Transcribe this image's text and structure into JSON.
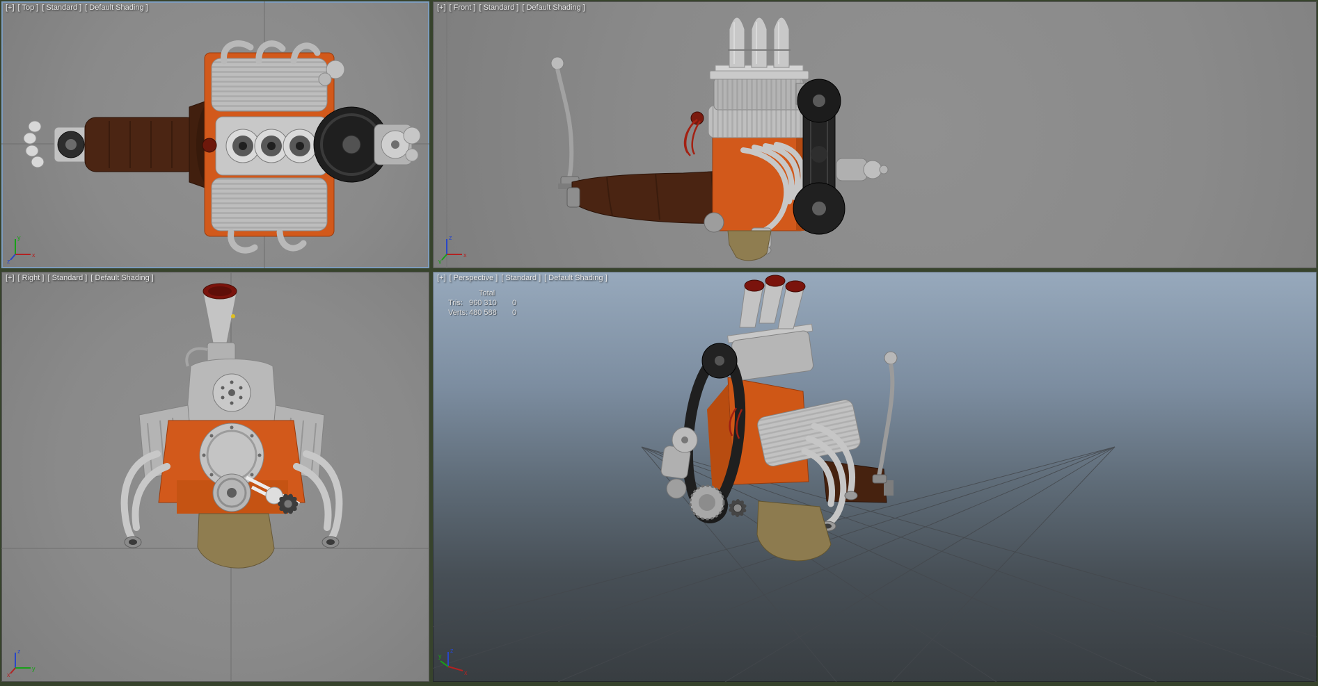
{
  "app": {
    "title": "3ds Max quad viewport - engine model"
  },
  "viewports": [
    {
      "id": "top",
      "menu_general": "[+]",
      "menu_pov": "[ Top ]",
      "menu_preset": "[ Standard ]",
      "menu_shading": "[ Default Shading ]",
      "active": true
    },
    {
      "id": "front",
      "menu_general": "[+]",
      "menu_pov": "[ Front ]",
      "menu_preset": "[ Standard ]",
      "menu_shading": "[ Default Shading ]",
      "active": false
    },
    {
      "id": "right",
      "menu_general": "[+]",
      "menu_pov": "[ Right ]",
      "menu_preset": "[ Standard ]",
      "menu_shading": "[ Default Shading ]",
      "active": false
    },
    {
      "id": "perspective",
      "menu_general": "[+]",
      "menu_pov": "[ Perspective ]",
      "menu_preset": "[ Standard ]",
      "menu_shading": "[ Default Shading ]",
      "active": false
    }
  ],
  "statistics": {
    "total_header": "Total",
    "rows": [
      {
        "label": "Tris:",
        "value": "960 310",
        "selected": "0"
      },
      {
        "label": "Verts:",
        "value": "480 588",
        "selected": "0"
      }
    ]
  },
  "axis_labels": {
    "x": "x",
    "y": "y",
    "z": "z"
  },
  "colors": {
    "active_viewport_border": "#7e9cbd",
    "ortho_viewport_background": "#8a8a8a",
    "divider": "#37432c",
    "perspective_sky_top": "#97a9bc",
    "perspective_ground_bottom": "#383d41",
    "engine_orange": "#d2591b",
    "transmission_brown": "#4b2513",
    "metal_gray": "#b5b5b5",
    "belt_black": "#212121",
    "oil_pan_tan": "#8f7d50",
    "stack_mouth_red": "#7a130c",
    "axis_x_color": "#b22222",
    "axis_y_color": "#18a018",
    "axis_z_color": "#2846c8"
  }
}
